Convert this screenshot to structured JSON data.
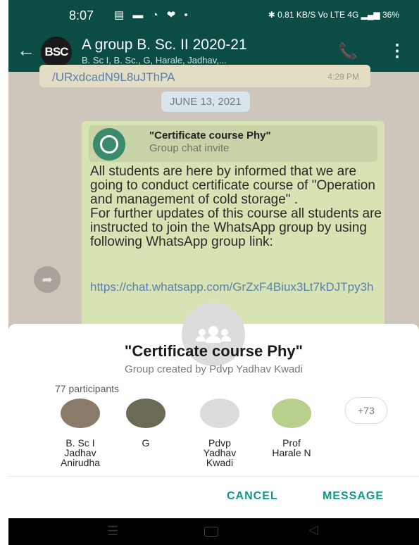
{
  "status_bar": {
    "time": "8:07",
    "icons_left": "▤ ▬ ◔ ❤ •",
    "right": "✱ 0.81 KB/S  Vo LTE  4G  ▂▄▆  36%"
  },
  "header": {
    "group_avatar_text": "BSC",
    "title": "A group B. Sc. II 2020-21",
    "subtitle": "B. Sc I, B. Sc., G, Harale, Jadhav,...",
    "back_glyph": "←",
    "add_call_glyph": "📞",
    "more_glyph": "⋮"
  },
  "chat": {
    "previous_link": "/URxdcadN9L8uJThPA",
    "previous_time": "4:29 PM",
    "date_chip": "JUNE 13, 2021",
    "invite_title": "\"Certificate course Phy\"",
    "invite_subtitle": "Group chat invite",
    "message_text": "All students are here by informed that we are going to conduct certificate course of \"Operation and management of cold storage\" .\n For further updates of this course all students are instructed to join the WhatsApp group by using following WhatsApp group link:",
    "link": "https://chat.whatsapp.com/GrZxF4Biux3Lt7kDJTpy3h",
    "forward_glyph": "➦"
  },
  "sheet": {
    "title": "\"Certificate course Phy\"",
    "subtitle": "Group created by Pdvp Yadhav Kwadi",
    "participants_count": "77 participants",
    "participants": [
      {
        "name": "B. Sc I\nJadhav\nAnirudha",
        "color": "#8a7a68"
      },
      {
        "name": "G",
        "color": "#6b6a55"
      },
      {
        "name": "Pdvp\nYadhav\nKwadi",
        "color": "#dcdcdc"
      },
      {
        "name": "Prof\nHarale N",
        "color": "#b9cf8c"
      }
    ],
    "more_count": "+73",
    "cancel_label": "CANCEL",
    "message_label": "MESSAGE"
  },
  "nav_bar": {
    "menu_glyph": "☰",
    "back_glyph": "◁"
  },
  "colors": {
    "header": "#0b4d44",
    "accent": "#0c9a88",
    "link": "#5b7fa9",
    "bubble": "#d8e3b4"
  }
}
